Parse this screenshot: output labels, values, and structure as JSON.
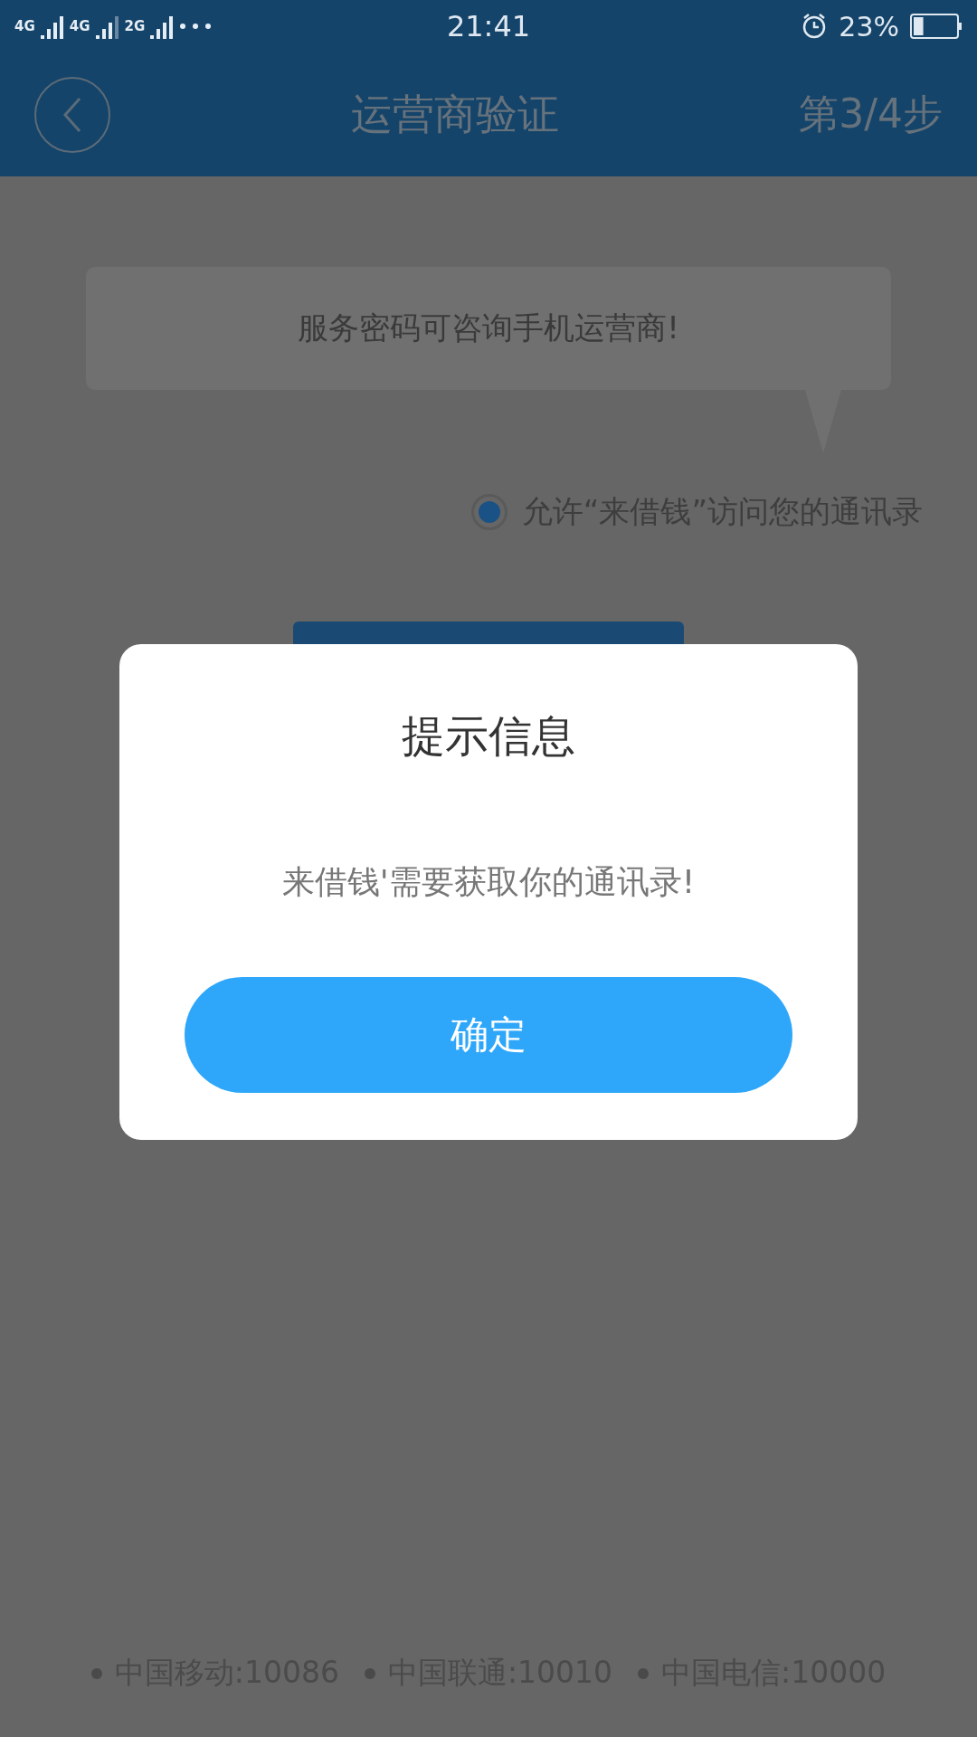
{
  "status_bar": {
    "networks": [
      "4G",
      "4G",
      "2G"
    ],
    "time": "21:41",
    "battery": "23%"
  },
  "header": {
    "title": "运营商验证",
    "step": "第3/4步"
  },
  "hint": "服务密码可咨询手机运营商!",
  "permission": {
    "label": "允许“来借钱”访问您的通讯录",
    "checked": true
  },
  "dialog": {
    "title": "提示信息",
    "message": "来借钱'需要获取你的通讯录!",
    "button": "确定"
  },
  "hotlines": [
    "中国移动:10086",
    "中国联通:10010",
    "中国电信:10000"
  ]
}
